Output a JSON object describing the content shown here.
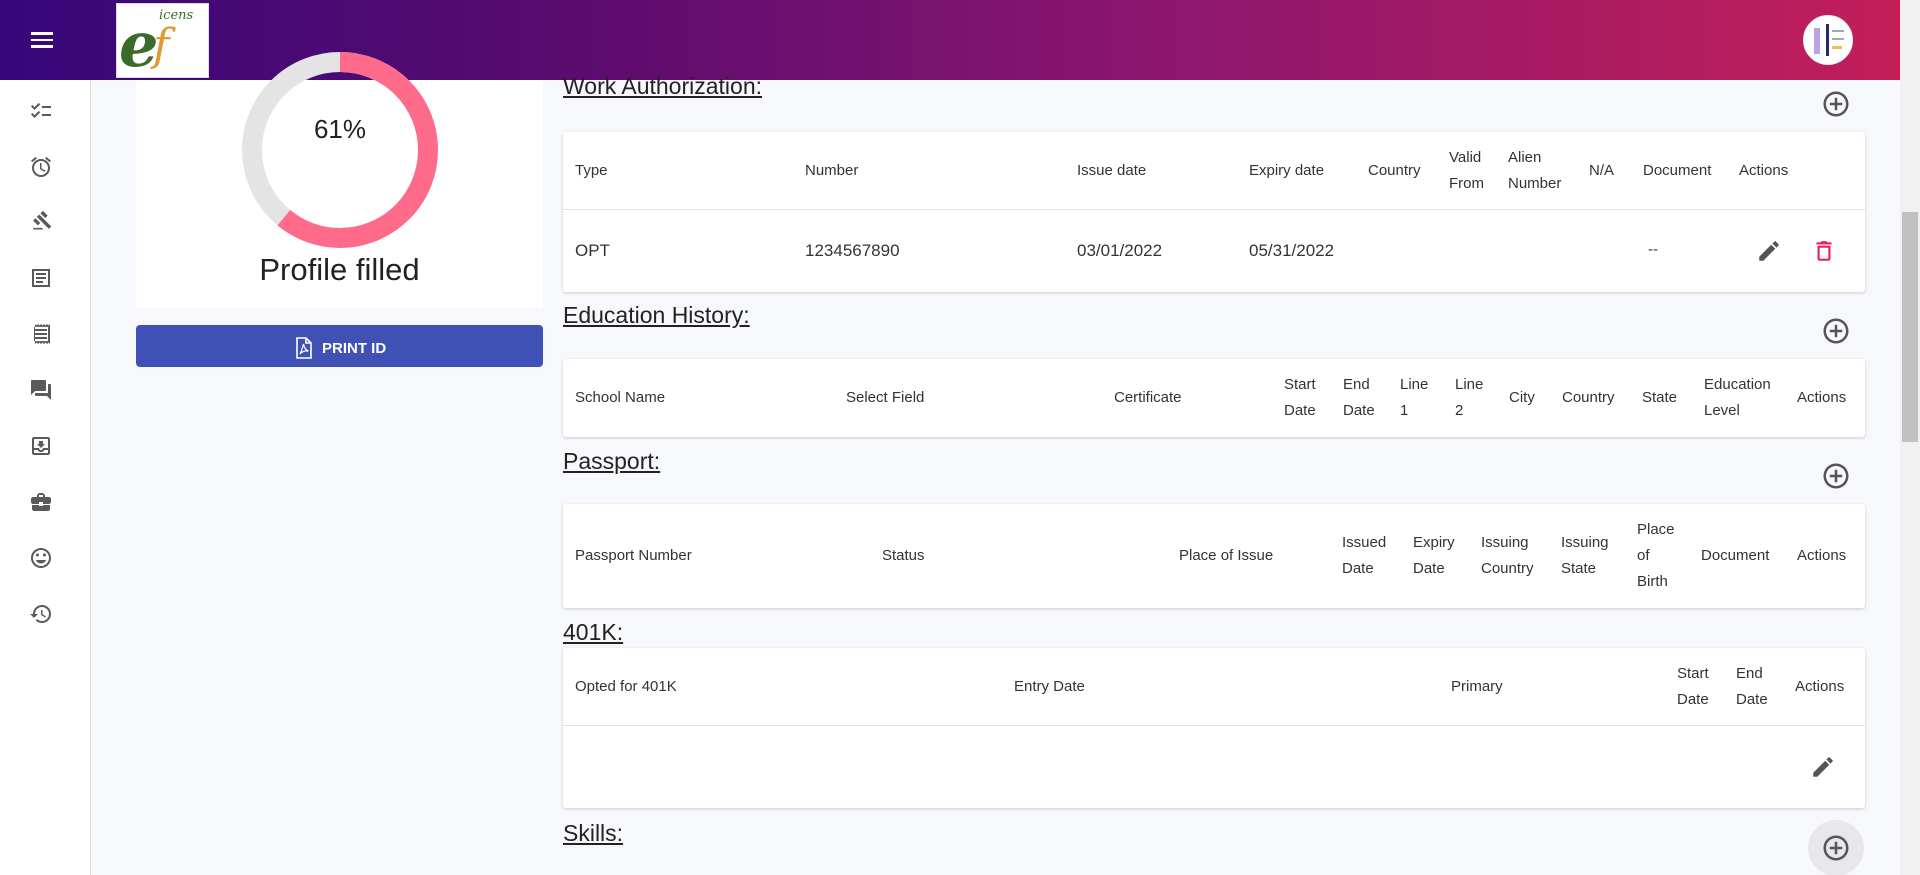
{
  "profile": {
    "percent_label": "61%",
    "percent": 61,
    "label": "Profile filled",
    "ring_fill_color": "#ff6b8b",
    "ring_track_color": "#e4e4e4"
  },
  "print_button": {
    "label": "PRINT ID"
  },
  "sidebar": {
    "icons": [
      "checklist-icon",
      "alarm-icon",
      "gavel-icon",
      "document-list-icon",
      "receipt-icon",
      "chat-icon",
      "mail-icon",
      "briefcase-icon",
      "face-icon",
      "history-icon"
    ]
  },
  "work_authorization": {
    "title": "Work Authorization:",
    "headers": [
      "Type",
      "Number",
      "Issue date",
      "Expiry date",
      "Country",
      "Valid\nFrom",
      "Alien\nNumber",
      "N/A",
      "Document",
      "Actions"
    ],
    "rows": [
      {
        "type": "OPT",
        "number": "1234567890",
        "issue_date": "03/01/2022",
        "expiry_date": "05/31/2022",
        "document": "--"
      }
    ]
  },
  "education_history": {
    "title": "Education History:",
    "headers": [
      "School Name",
      "Select Field",
      "Certificate",
      "Start\nDate",
      "End\nDate",
      "Line\n1",
      "Line\n2",
      "City",
      "Country",
      "State",
      "Education\nLevel",
      "Actions"
    ]
  },
  "passport": {
    "title": "Passport:",
    "headers": [
      "Passport Number",
      "Status",
      "Place of Issue",
      "Issued\nDate",
      "Expiry\nDate",
      "Issuing\nCountry",
      "Issuing\nState",
      "Place\nof\nBirth",
      "Document",
      "Actions"
    ]
  },
  "k401": {
    "title": "401K:",
    "headers": [
      "Opted for 401K",
      "Entry Date",
      "Primary",
      "Start\nDate",
      "End\nDate",
      "Actions"
    ]
  },
  "skills": {
    "title": "Skills:"
  },
  "colors": {
    "accent": "#3f51b5",
    "delete": "#e0245e"
  }
}
